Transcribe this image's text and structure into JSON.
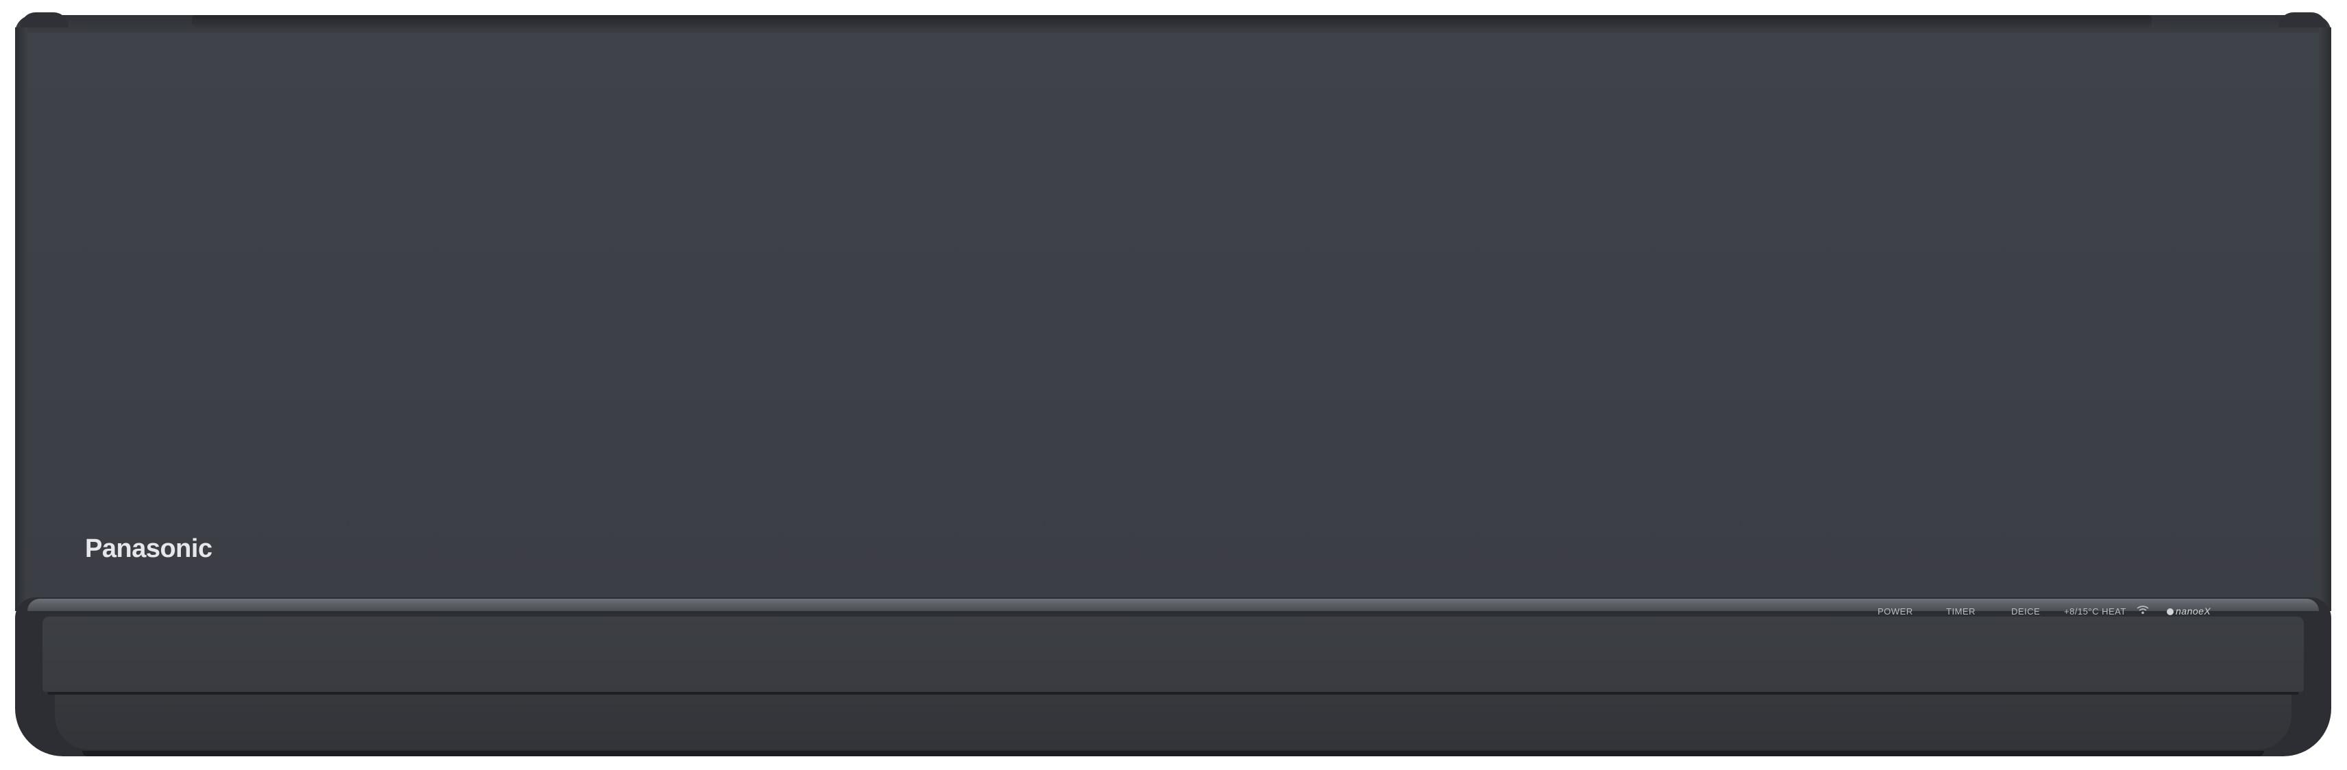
{
  "brand": {
    "logo_text": "Panasonic"
  },
  "indicators": {
    "power": "POWER",
    "timer": "TIMER",
    "deice": "DEICE",
    "heat": "+8/15°C HEAT",
    "wifi_icon": "wifi-icon",
    "nanoe": "nanoeX"
  },
  "colors": {
    "body": "#3d4047",
    "bezel": "#2c2e33",
    "logo": "#e6e7ea",
    "indicator_text": "#b9bcc2"
  }
}
